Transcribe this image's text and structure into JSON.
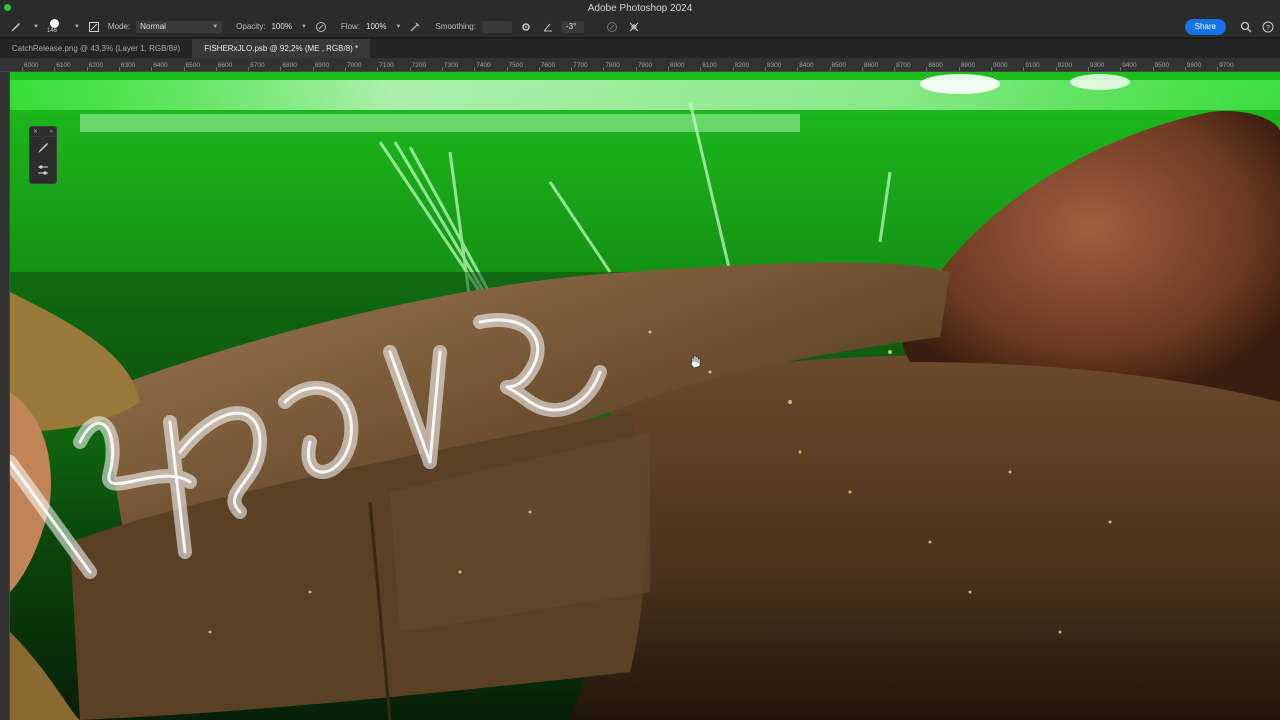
{
  "app": {
    "title": "Adobe Photoshop 2024"
  },
  "options": {
    "brush_size": "146",
    "mode_label": "Mode:",
    "mode_value": "Normal",
    "opacity_label": "Opacity:",
    "opacity_value": "100%",
    "flow_label": "Flow:",
    "flow_value": "100%",
    "smoothing_label": "Smoothing:",
    "smoothing_value": "",
    "angle_value": "-3°",
    "share_label": "Share"
  },
  "tabs": [
    {
      "label": "CatchRelease.png @ 43,3% (Layer 1, RGB/8#)",
      "active": false
    },
    {
      "label": "FISHERxJLO.psb @ 92,2% (ME , RGB/8) *",
      "active": true
    }
  ],
  "ruler": {
    "ticks": [
      "6000",
      "6100",
      "6200",
      "6300",
      "6400",
      "6500",
      "6600",
      "6700",
      "6800",
      "6900",
      "7000",
      "7100",
      "7200",
      "7300",
      "7400",
      "7500",
      "7600",
      "7700",
      "7800",
      "7900",
      "8000",
      "8100",
      "8200",
      "8300",
      "8400",
      "8500",
      "8600",
      "8700",
      "8800",
      "8900",
      "9000",
      "9100",
      "9200",
      "9300",
      "9400",
      "9500",
      "9600",
      "9700"
    ]
  },
  "colors": {
    "accent": "#1473e6",
    "laser_green": "#22e622",
    "skin": "#8a6a45"
  }
}
